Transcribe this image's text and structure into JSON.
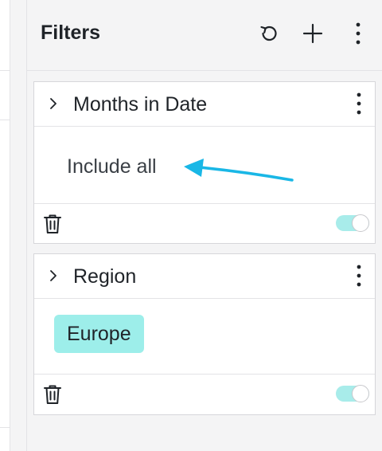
{
  "panel": {
    "title": "Filters",
    "actions": [
      {
        "name": "reset",
        "icon": "reset-icon"
      },
      {
        "name": "add",
        "icon": "plus-icon"
      },
      {
        "name": "more",
        "icon": "kebab-icon"
      }
    ]
  },
  "filters": [
    {
      "title": "Months in Date",
      "value": "Include all",
      "enabled": true,
      "annotation": "arrow-pointer-icon"
    },
    {
      "title": "Region",
      "chip": "Europe",
      "enabled": true
    }
  ],
  "colors": {
    "accent_toggle": "#a8ecea",
    "chip": "#9deeea",
    "annotation_arrow": "#19b7e6"
  }
}
